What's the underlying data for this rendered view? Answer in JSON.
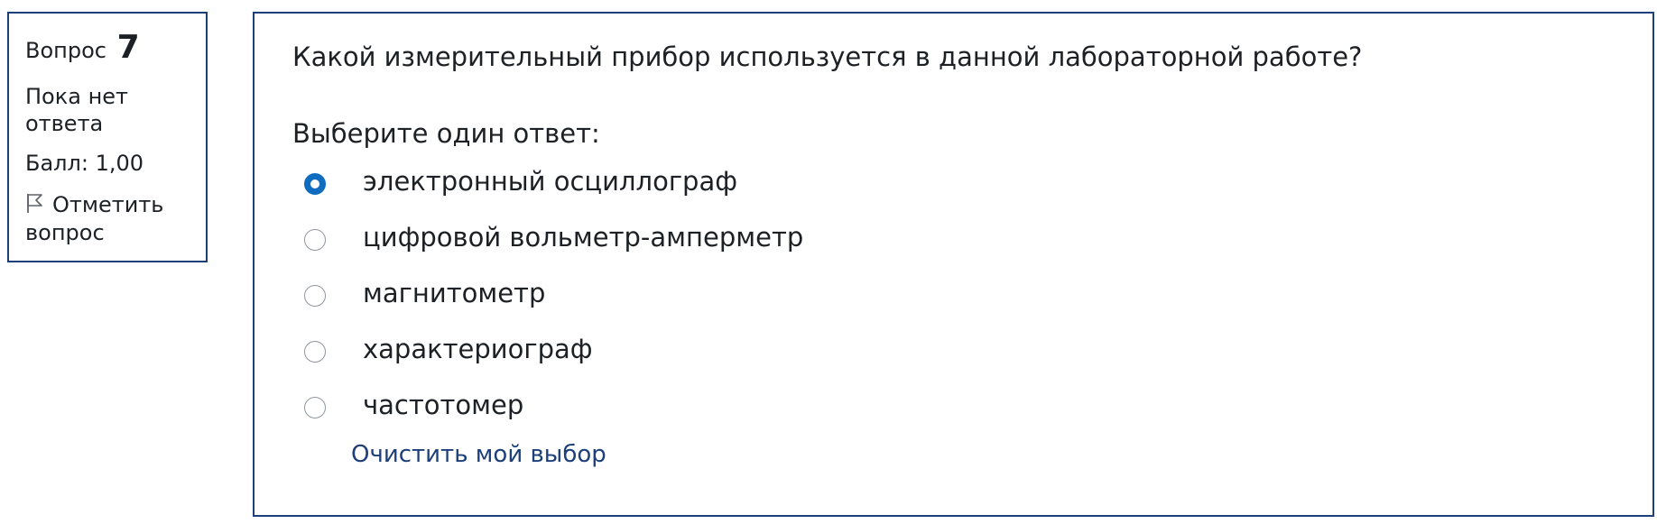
{
  "info": {
    "question_label": "Вопрос",
    "question_number": "7",
    "state": "Пока нет ответа",
    "grade": "Балл: 1,00",
    "flag_label": "Отметить вопрос",
    "flag_icon": "flag-icon"
  },
  "question": {
    "text": "Какой измерительный прибор используется в данной лабораторной работе?",
    "prompt": "Выберите один ответ:",
    "options": [
      {
        "label": "электронный осциллограф",
        "selected": true
      },
      {
        "label": "цифровой вольметр-амперметр",
        "selected": false
      },
      {
        "label": "магнитометр",
        "selected": false
      },
      {
        "label": "характериограф",
        "selected": false
      },
      {
        "label": "частотомер",
        "selected": false
      }
    ],
    "clear_label": "Очистить мой выбор"
  },
  "colors": {
    "border": "#1d3f7a",
    "link": "#1d3f7a",
    "radio_selected": "#0f6cbf",
    "text": "#1d2125"
  }
}
